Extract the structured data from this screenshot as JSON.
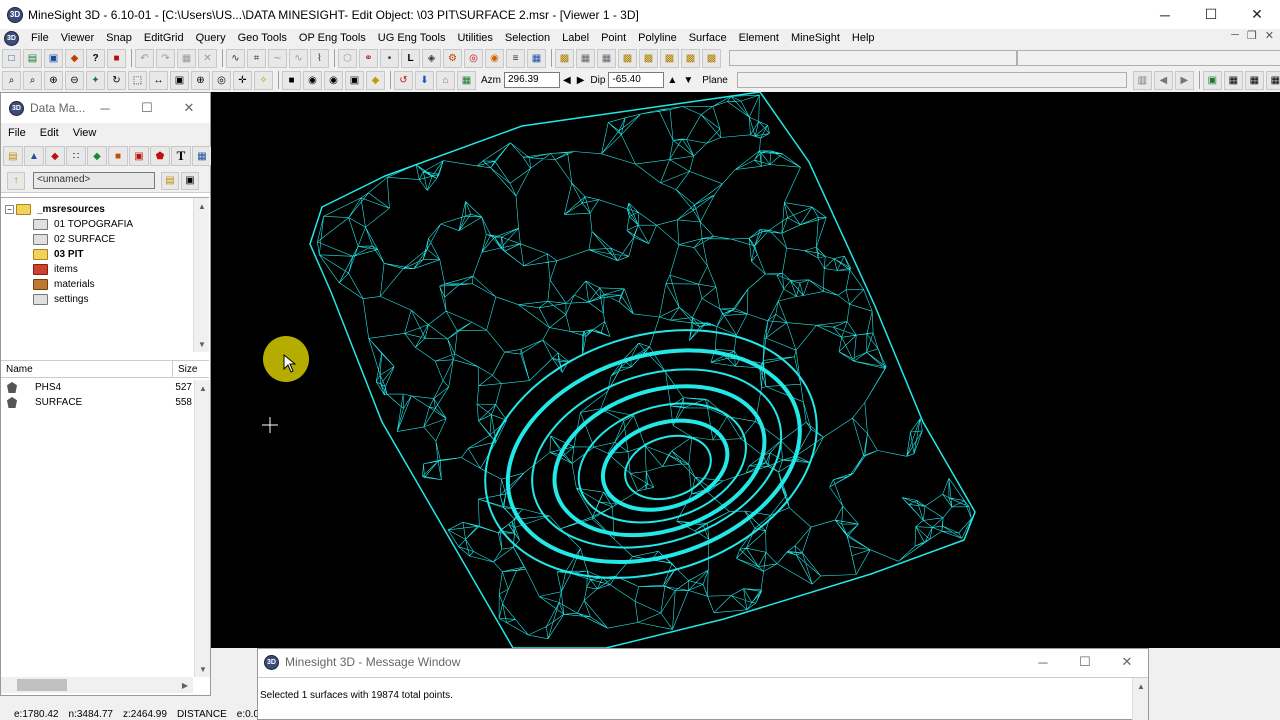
{
  "app": {
    "title": "MineSight 3D - 6.10-01 - [C:\\Users\\US...\\DATA MINESIGHT- Edit Object: \\03 PIT\\SURFACE 2.msr - [Viewer 1 - 3D]",
    "icon_text": "3D"
  },
  "menubar": [
    "File",
    "Viewer",
    "Snap",
    "EditGrid",
    "Query",
    "Geo Tools",
    "OP Eng Tools",
    "UG Eng Tools",
    "Utilities",
    "Selection",
    "Label",
    "Point",
    "Polyline",
    "Surface",
    "Element",
    "MineSight",
    "Help"
  ],
  "toolbar": {
    "azm_label": "Azm",
    "azm_value": "296.39",
    "dip_label": "Dip",
    "dip_value": "-65.40",
    "plane_label": "Plane"
  },
  "data_manager": {
    "title": "Data Ma...",
    "menu": [
      "File",
      "Edit",
      "View"
    ],
    "path_value": "<unnamed>",
    "tree": [
      {
        "label": "_msresources",
        "bold": true,
        "level": 0,
        "expander": "−"
      },
      {
        "label": "01 TOPOGRAFIA",
        "bold": false,
        "level": 1
      },
      {
        "label": "02 SURFACE",
        "bold": false,
        "level": 1
      },
      {
        "label": "03 PIT",
        "bold": true,
        "level": 1
      },
      {
        "label": "items",
        "bold": false,
        "level": 1
      },
      {
        "label": "materials",
        "bold": false,
        "level": 1
      },
      {
        "label": "settings",
        "bold": false,
        "level": 1
      }
    ],
    "list_headers": {
      "name": "Name",
      "size": "Size"
    },
    "list_rows": [
      {
        "name": "PHS4",
        "size": "527"
      },
      {
        "name": "SURFACE",
        "size": "558"
      }
    ]
  },
  "message_window": {
    "title": "Minesight 3D - Message Window",
    "text": "Selected 1 surfaces with 19874 total points."
  },
  "statusbar": {
    "e": "e:1780.42",
    "n": "n:3484.77",
    "z": "z:2464.99",
    "mode": "DISTANCE",
    "extra": "e:0.0"
  },
  "colors": {
    "wireframe": "#22e8e8",
    "viewport_bg": "#000000",
    "cursor_highlight": "#c8c000"
  }
}
